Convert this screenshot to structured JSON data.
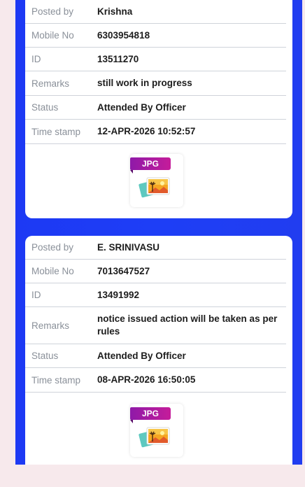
{
  "complaints": [
    {
      "posted_by_label": "Posted by",
      "posted_by": "Krishna",
      "mobile_label": "Mobile No",
      "mobile": "6303954818",
      "id_label": "ID",
      "id": "13511270",
      "remarks_label": "Remarks",
      "remarks": "still work in progress",
      "status_label": "Status",
      "status": "Attended By Officer",
      "timestamp_label": "Time stamp",
      "timestamp": "12-APR-2026 10:52:57",
      "attachment_label": "JPG",
      "attachment_icon": "jpg-file-icon"
    },
    {
      "posted_by_label": "Posted by",
      "posted_by": "E. SRINIVASU",
      "mobile_label": "Mobile No",
      "mobile": "7013647527",
      "id_label": "ID",
      "id": "13491992",
      "remarks_label": "Remarks",
      "remarks": "notice issued action will be taken as per rules",
      "status_label": "Status",
      "status": "Attended By Officer",
      "timestamp_label": "Time stamp",
      "timestamp": "08-APR-2026 16:50:05",
      "attachment_label": "JPG",
      "attachment_icon": "jpg-file-icon"
    }
  ],
  "colors": {
    "panel_blue": "#1e3ef6",
    "page_bg": "#f7e9ec",
    "label_gray": "#8a9099",
    "jpg_tag": "#b01ca0"
  }
}
